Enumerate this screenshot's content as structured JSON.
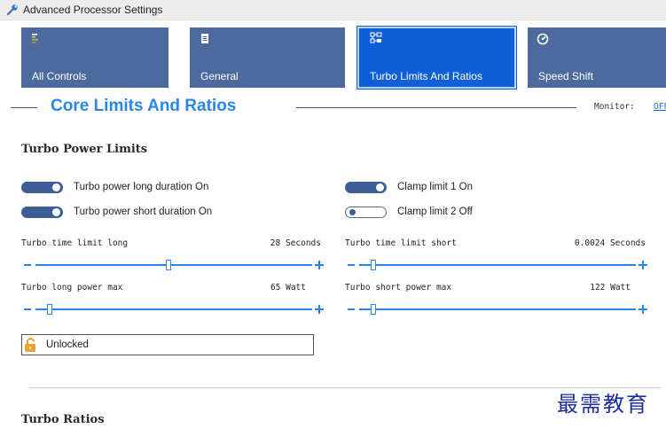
{
  "window": {
    "title": "Advanced Processor Settings",
    "icon": "wrench-icon"
  },
  "tiles": [
    {
      "label": "All Controls",
      "icon": "bar-list-icon",
      "active": false
    },
    {
      "label": "General",
      "icon": "document-icon",
      "active": false
    },
    {
      "label": "Turbo Limits And Ratios",
      "icon": "chip-grid-icon",
      "active": true
    },
    {
      "label": "Speed Shift",
      "icon": "speedometer-icon",
      "active": false
    }
  ],
  "section": {
    "heading": "Core Limits And Ratios",
    "monitor_label": "Monitor:",
    "monitor_value": "OFF"
  },
  "turbo_power_limits": {
    "heading": "Turbo Power Limits",
    "toggles": {
      "long_duration": {
        "label": "Turbo power long duration On",
        "on": true
      },
      "short_duration": {
        "label": "Turbo power short duration On",
        "on": true
      },
      "clamp1": {
        "label": "Clamp limit 1 On",
        "on": true
      },
      "clamp2": {
        "label": "Clamp limit 2 Off",
        "on": false
      }
    },
    "params": {
      "time_long": {
        "label": "Turbo time limit long",
        "value": "28 Seconds",
        "level": 0.48
      },
      "time_short": {
        "label": "Turbo time limit short",
        "value": "0.0024 Seconds",
        "level": 0.05
      },
      "power_long": {
        "label": "Turbo long power max",
        "value": "65 Watt",
        "level": 0.05
      },
      "power_short": {
        "label": "Turbo short power max",
        "value": "122 Watt",
        "level": 0.05
      }
    },
    "lock": {
      "label": "Unlocked",
      "icon": "unlocked-padlock-icon",
      "color": "#f0a030"
    }
  },
  "turbo_ratios": {
    "heading": "Turbo Ratios"
  },
  "watermark": "最需教育",
  "colors": {
    "tile": "#4c6a9e",
    "tile_active": "#0f5fd6",
    "accent": "#2a86e8",
    "toggle": "#3d5f96"
  }
}
